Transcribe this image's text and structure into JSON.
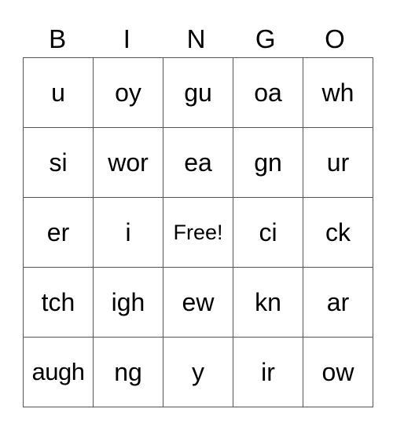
{
  "header": [
    "B",
    "I",
    "N",
    "G",
    "O"
  ],
  "rows": [
    [
      "u",
      "oy",
      "gu",
      "oa",
      "wh"
    ],
    [
      "si",
      "wor",
      "ea",
      "gn",
      "ur"
    ],
    [
      "er",
      "i",
      "Free!",
      "ci",
      "ck"
    ],
    [
      "tch",
      "igh",
      "ew",
      "kn",
      "ar"
    ],
    [
      "augh",
      "ng",
      "y",
      "ir",
      "ow"
    ]
  ]
}
